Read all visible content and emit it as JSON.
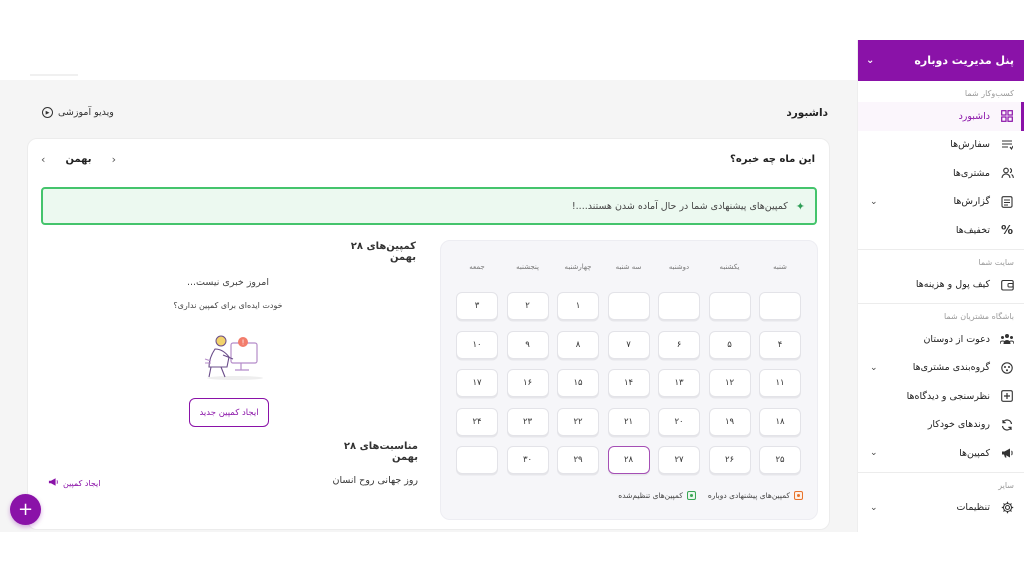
{
  "sidebar": {
    "title": "پنل مدیریت دوباره",
    "sections": [
      {
        "label": "کسب‌وکار شما",
        "items": [
          {
            "label": "داشبورد",
            "icon": "dashboard-icon",
            "active": true
          },
          {
            "label": "سفارش‌ها",
            "icon": "orders-icon"
          },
          {
            "label": "مشتری‌ها",
            "icon": "customers-icon"
          },
          {
            "label": "گزارش‌ها",
            "icon": "reports-icon",
            "expandable": true
          },
          {
            "label": "تخفیف‌ها",
            "icon": "percent-icon"
          }
        ]
      },
      {
        "label": "سایت شما",
        "items": [
          {
            "label": "کیف پول و هزینه‌ها",
            "icon": "wallet-icon"
          }
        ]
      },
      {
        "label": "باشگاه مشتریان شما",
        "items": [
          {
            "label": "دعوت از دوستان",
            "icon": "invite-icon"
          },
          {
            "label": "گروه‌بندی مشتری‌ها",
            "icon": "segments-icon",
            "expandable": true
          },
          {
            "label": "نظرسنجی و دیدگاه‌ها",
            "icon": "survey-icon"
          },
          {
            "label": "روندهای خودکار",
            "icon": "automation-icon"
          },
          {
            "label": "کمپین‌ها",
            "icon": "campaign-icon",
            "expandable": true
          }
        ]
      },
      {
        "label": "سایر",
        "items": [
          {
            "label": "تنظیمات",
            "icon": "settings-icon",
            "expandable": true
          }
        ]
      }
    ]
  },
  "header": {
    "title": "داشبورد",
    "video_link": "ویدیو آموزشی"
  },
  "card": {
    "title": "این ماه چه خبره؟",
    "month": "بهمن",
    "banner": "کمپین‌های پیشنهادی شما در حال آماده شدن هستند....!"
  },
  "calendar": {
    "weekdays": [
      "شنبه",
      "یکشنبه",
      "دوشنبه",
      "سه شنبه",
      "چهارشنبه",
      "پنجشنبه",
      "جمعه"
    ],
    "weeks": [
      [
        "",
        "",
        "",
        "",
        "۱",
        "۲",
        "۳"
      ],
      [
        "۴",
        "۵",
        "۶",
        "۷",
        "۸",
        "۹",
        "۱۰"
      ],
      [
        "۱۱",
        "۱۲",
        "۱۳",
        "۱۴",
        "۱۵",
        "۱۶",
        "۱۷"
      ],
      [
        "۱۸",
        "۱۹",
        "۲۰",
        "۲۱",
        "۲۲",
        "۲۳",
        "۲۴"
      ],
      [
        "۲۵",
        "۲۶",
        "۲۷",
        "۲۸",
        "۲۹",
        "۳۰",
        ""
      ]
    ],
    "today": "۲۸",
    "legend": {
      "suggested": "کمپین‌های پیشنهادی دوباره",
      "scheduled": "کمپین‌های تنظیم‌شده",
      "suggested_color": "#e8732c",
      "scheduled_color": "#3aa655"
    }
  },
  "day_panel": {
    "campaigns_title": "کمپین‌های ۲۸ بهمن",
    "no_news": "امروز خبری نیست...",
    "idea_prompt": "خودت ایده‌ای برای کمپین نداری؟",
    "new_campaign_button": "ایجاد کمپین جدید",
    "occasions_title": "مناسبت‌های ۲۸ بهمن",
    "occasion": "روز جهانی روح انسان",
    "create_campaign_link": "ایجاد کمپین"
  },
  "fab": {
    "label": "+"
  },
  "colors": {
    "brand": "#8a12a8",
    "banner_border": "#44c46c",
    "banner_bg": "#ecf9f0"
  }
}
